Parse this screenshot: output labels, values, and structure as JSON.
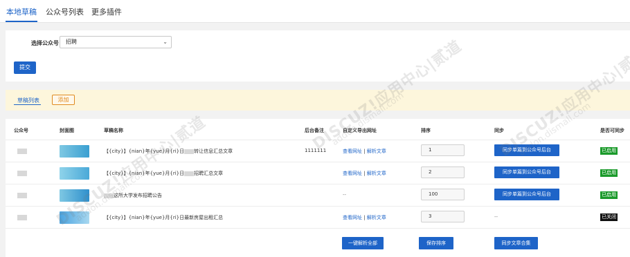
{
  "topnav": {
    "tabs": [
      {
        "label": "本地草稿",
        "active": true
      },
      {
        "label": "公众号列表",
        "active": false
      },
      {
        "label": "更多插件",
        "active": false
      }
    ]
  },
  "filter": {
    "label": "选择公众号",
    "selected": "招聘",
    "submit_label": "提交"
  },
  "toolbar": {
    "list_tab": "草稿列表",
    "add_label": "添加"
  },
  "table": {
    "headers": [
      "公众号",
      "封面图",
      "草稿名称",
      "后台备注",
      "自定义导出网址",
      "排序",
      "同步",
      "是否可同步"
    ],
    "rows": [
      {
        "name_prefix": "【{city}】{nian}年{yue}月{ri}日",
        "name_suffix": "转让信息汇总文章",
        "remark": "1111111",
        "link_view": "查看网址",
        "link_parse": "解析文章",
        "sep": "|",
        "order": "1",
        "sync_label": "同步单篇到公众号后台",
        "status": "已启用"
      },
      {
        "name_prefix": "【{city}】{nian}年{yue}月{ri}日",
        "name_suffix": "招聘汇总文章",
        "remark": "",
        "link_view": "查看网址",
        "link_parse": "解析文章",
        "sep": "|",
        "order": "2",
        "sync_label": "同步单篇到公众号后台",
        "status": "已启用"
      },
      {
        "name_prefix": "",
        "name_suffix": "这所大学发布招聘公告",
        "remark": "",
        "link_dash": "--",
        "order": "100",
        "sync_label": "同步单篇到公众号后台",
        "status": "已启用"
      },
      {
        "name_prefix": "【{city}】{nian}年{yue}月{ri}日",
        "name_suffix": "最新房屋出租汇总",
        "remark": "",
        "link_view": "查看网址",
        "link_parse": "解析文章",
        "sep": "|",
        "order": "3",
        "sync_dash": "--",
        "status": "已关闭"
      }
    ],
    "actions": {
      "parse_all": "一键解析全部",
      "save_order": "保存排序",
      "sync_merge": "同步文章合集"
    }
  },
  "watermark": {
    "text": "DISCUZ!应用中心|贰道",
    "sub": "addon.dismall.com"
  },
  "colors": {
    "primary": "#1e64c8",
    "enabled": "#1a9a2a",
    "disabled": "#111111",
    "accent": "#e08a1e"
  }
}
